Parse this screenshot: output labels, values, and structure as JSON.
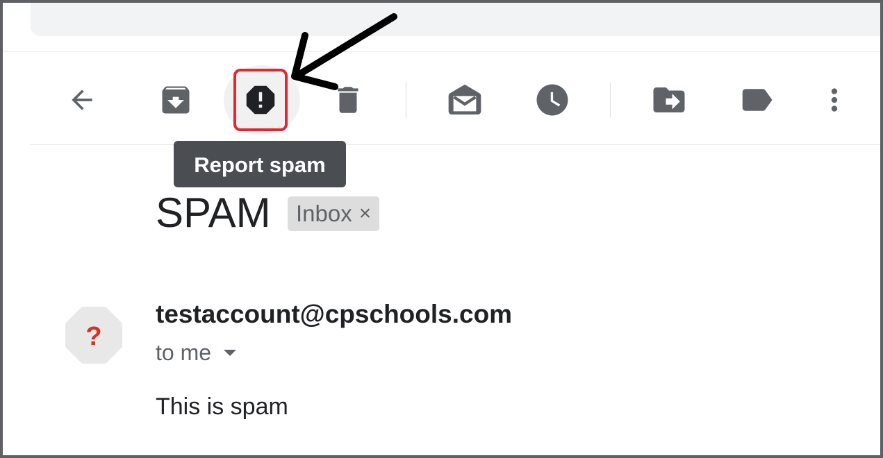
{
  "toolbar": {
    "icons": {
      "back": "arrow-left-icon",
      "archive": "archive-icon",
      "report_spam": "report-spam-icon",
      "delete": "trash-icon",
      "mark_unread": "mark-as-unread-icon",
      "snooze": "clock-icon",
      "move_to": "move-to-icon",
      "labels": "label-icon",
      "more": "more-vert-icon"
    },
    "tooltip": "Report spam"
  },
  "message": {
    "subject": "SPAM",
    "label_chip": "Inbox",
    "label_chip_close": "×",
    "sender": "testaccount@cpschools.com",
    "recipient": "to me",
    "avatar_glyph": "?",
    "body": "This is spam"
  },
  "colors": {
    "icon": "#5f6368",
    "highlight": "#e3262f",
    "tooltip_bg": "#4a4e52",
    "avatar_bg": "#e8e8e8",
    "avatar_glyph": "#d93025",
    "annotation_arrow": "#000000"
  }
}
